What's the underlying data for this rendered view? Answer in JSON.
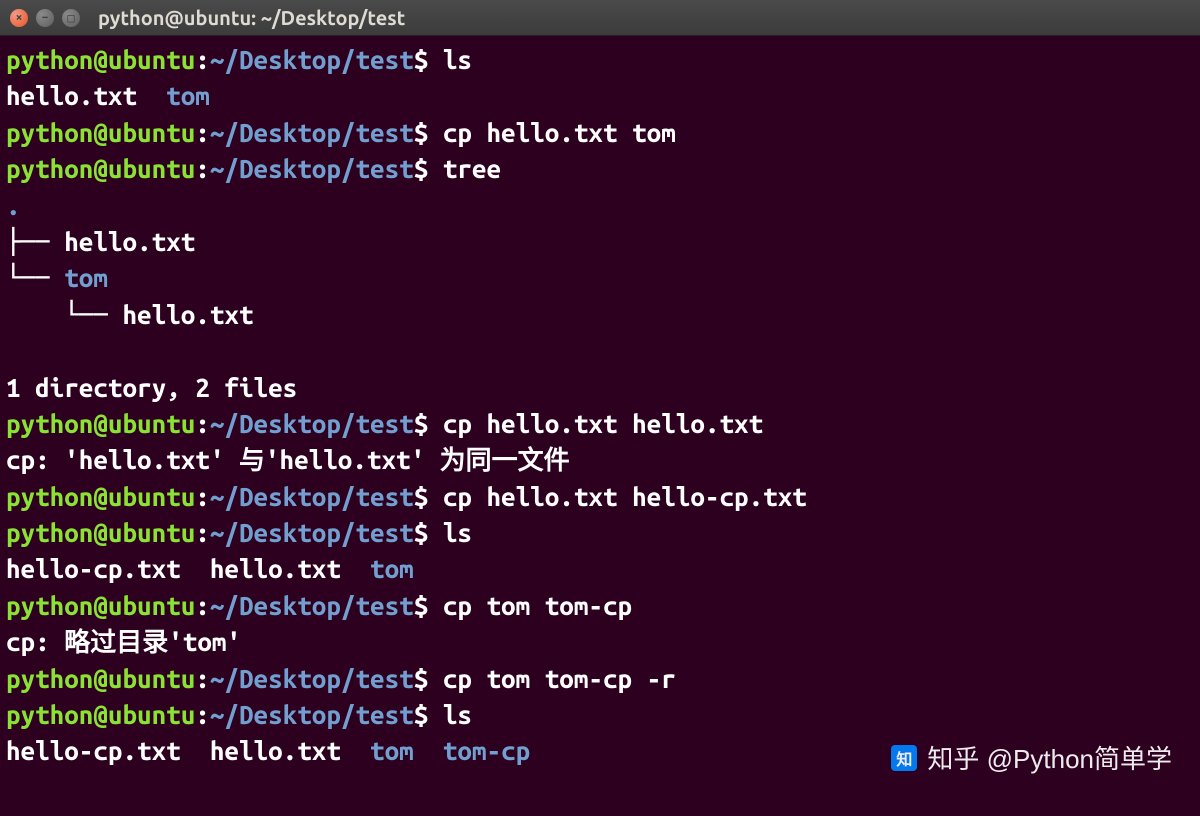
{
  "titlebar": {
    "title": "python@ubuntu: ~/Desktop/test"
  },
  "prompt": {
    "user_host": "python@ubuntu",
    "colon": ":",
    "path": "~/Desktop/test",
    "dollar": "$"
  },
  "lines": {
    "cmd1": "ls",
    "ls1_file1": "hello.txt",
    "ls1_dir1": "tom",
    "cmd2": "cp hello.txt tom",
    "cmd3": "tree",
    "tree_dot": ".",
    "tree_branch1": "├── ",
    "tree_f1": "hello.txt",
    "tree_branch2": "└── ",
    "tree_d1": "tom",
    "tree_branch3": "    └── ",
    "tree_f2": "hello.txt",
    "tree_summary": "1 directory, 2 files",
    "cmd4": "cp hello.txt hello.txt",
    "err1": "cp: 'hello.txt' 与'hello.txt' 为同一文件",
    "cmd5": "cp hello.txt hello-cp.txt",
    "cmd6": "ls",
    "ls2_f1": "hello-cp.txt",
    "ls2_f2": "hello.txt",
    "ls2_d1": "tom",
    "cmd7": "cp tom tom-cp",
    "err2": "cp: 略过目录'tom'",
    "cmd8": "cp tom tom-cp -r",
    "cmd9": "ls",
    "ls3_f1": "hello-cp.txt",
    "ls3_f2": "hello.txt",
    "ls3_d1": "tom",
    "ls3_d2": "tom-cp"
  },
  "watermark": {
    "icon": "知",
    "text": "知乎 @Python简单学"
  }
}
